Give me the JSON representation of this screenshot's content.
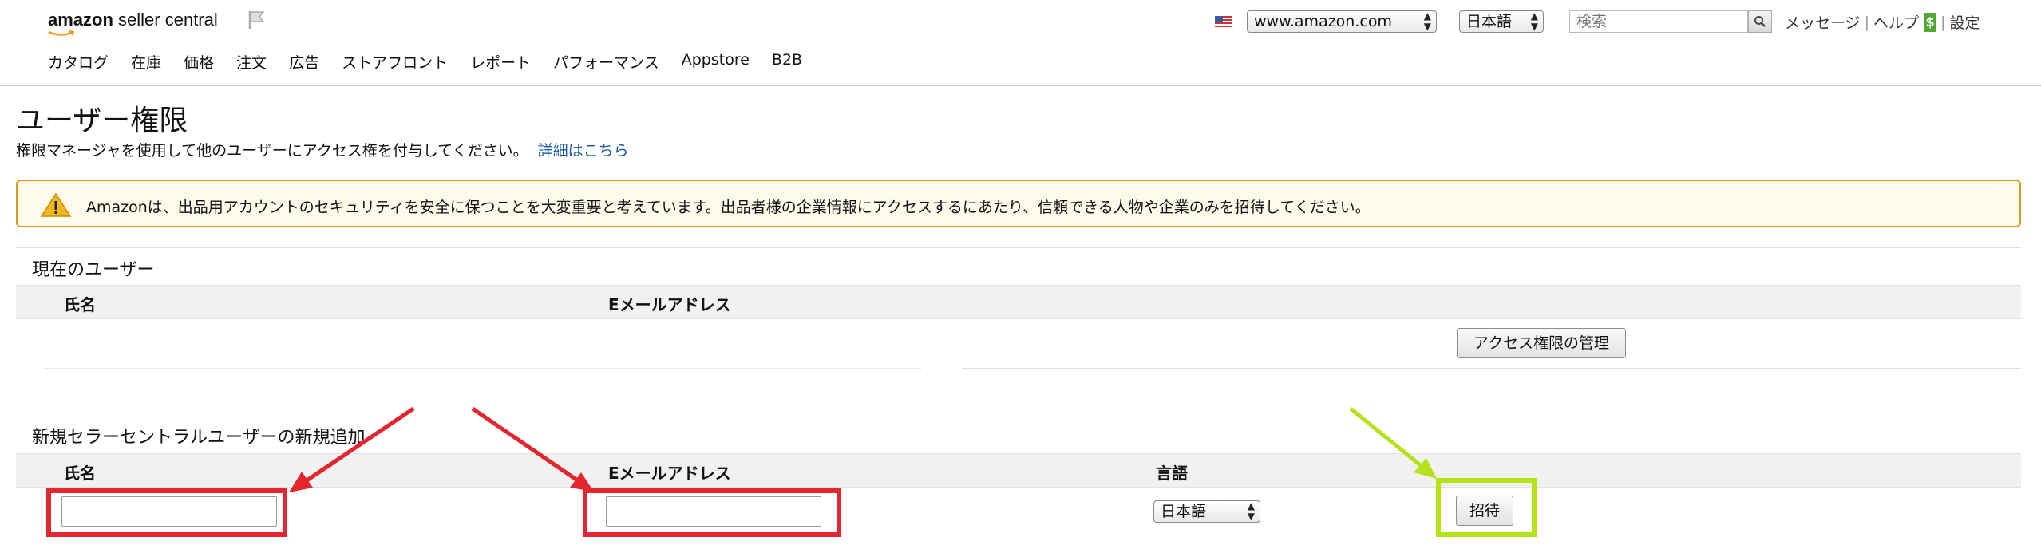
{
  "header": {
    "logo_bold": "amazon",
    "logo_rest": " seller central",
    "marketplace": "www.amazon.com",
    "language": "日本語",
    "search_placeholder": "検索",
    "messages": "メッセージ",
    "help": "ヘルプ",
    "help_badge": "$",
    "settings": "設定"
  },
  "nav": [
    "カタログ",
    "在庫",
    "価格",
    "注文",
    "広告",
    "ストアフロント",
    "レポート",
    "パフォーマンス",
    "Appstore",
    "B2B"
  ],
  "page": {
    "title": "ユーザー権限",
    "description": "権限マネージャを使用して他のユーザーにアクセス権を付与してください。",
    "details_link": "詳細はこちら"
  },
  "alert": {
    "text": "Amazonは、出品用アカウントのセキュリティを安全に保つことを大変重要と考えています。出品者様の企業情報にアクセスするにあたり、信頼できる人物や企業のみを招待してください。"
  },
  "current_users": {
    "title": "現在のユーザー",
    "col_name": "氏名",
    "col_email": "Eメールアドレス",
    "manage_button": "アクセス権限の管理"
  },
  "new_user": {
    "title": "新規セラーセントラルユーザーの新規追加",
    "col_name": "氏名",
    "col_email": "Eメールアドレス",
    "col_language": "言語",
    "name_value": "",
    "email_value": "",
    "language_value": "日本語",
    "invite_button": "招待"
  },
  "colors": {
    "highlight_red": "#e3262d",
    "highlight_green": "#b4e31b",
    "alert_border": "#d59c1a",
    "link": "#1a5aa0"
  }
}
